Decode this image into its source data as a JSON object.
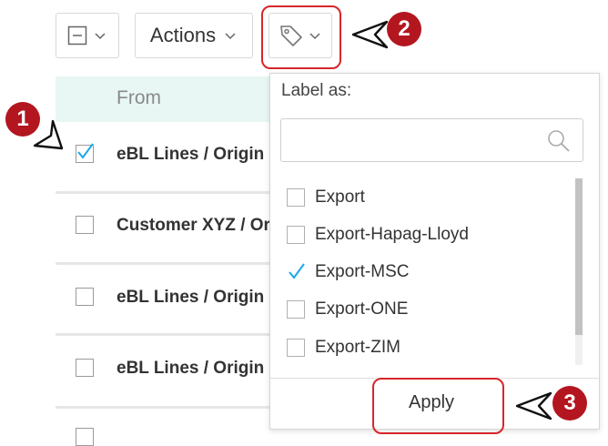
{
  "toolbar": {
    "actions_label": "Actions"
  },
  "list": {
    "column_from": "From",
    "rows": [
      {
        "from": "eBL Lines / Origin",
        "checked": true
      },
      {
        "from": "Customer XYZ / Origin",
        "checked": false
      },
      {
        "from": "eBL Lines / Origin",
        "checked": false
      },
      {
        "from": "eBL Lines / Origin",
        "checked": false
      }
    ]
  },
  "label_menu": {
    "heading": "Label as:",
    "search_placeholder": "",
    "options": [
      {
        "label": "Export",
        "checked": false
      },
      {
        "label": "Export-Hapag-Lloyd",
        "checked": false
      },
      {
        "label": "Export-MSC",
        "checked": true
      },
      {
        "label": "Export-ONE",
        "checked": false
      },
      {
        "label": "Export-ZIM",
        "checked": false
      }
    ],
    "apply_label": "Apply"
  },
  "annotations": {
    "step1": "1",
    "step2": "2",
    "step3": "3",
    "color": "#b3161e"
  },
  "colors": {
    "check_accent": "#1aa9e8",
    "header_bg": "#e8f7f4"
  }
}
